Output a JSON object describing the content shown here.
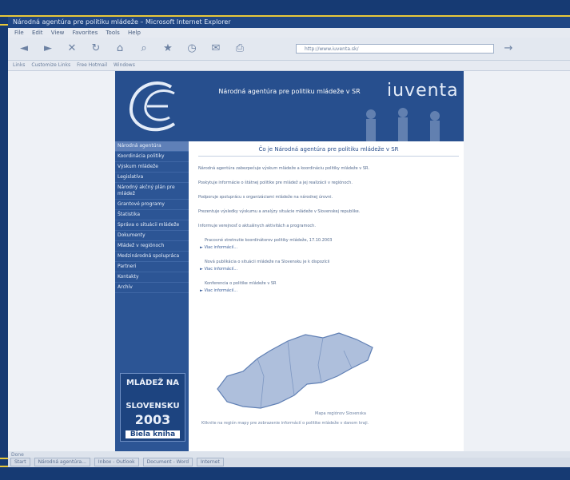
{
  "window": {
    "title": "Národná agentúra pre politiku mládeže – Microsoft Internet Explorer"
  },
  "menu": [
    "File",
    "Edit",
    "View",
    "Favorites",
    "Tools",
    "Help"
  ],
  "address": {
    "url": "http://www.iuventa.sk/"
  },
  "links_bar": [
    "Links",
    "Customize Links",
    "Free Hotmail",
    "Windows"
  ],
  "banner": {
    "title": "Národná agentúra pre politiku mládeže v SR",
    "brand": "iuventa"
  },
  "sidebar": {
    "items": [
      "Národná agentúra",
      "Koordinácia politiky",
      "Výskum mládeže",
      "Legislatíva",
      "Národný akčný plán pre mládež",
      "Grantové programy",
      "Štatistika",
      "Správa o situácii mládeže",
      "Dokumenty",
      "Mládež v regiónoch",
      "Medzinárodná spolupráca",
      "Partneri",
      "Kontakty",
      "Archív"
    ],
    "promo": {
      "line1": "MLÁDEŽ NA",
      "line2": "SLOVENSKU",
      "line3": "2003",
      "line4": "Biela kniha"
    }
  },
  "main": {
    "heading": "Čo je Národná agentúra pre politiku mládeže v SR",
    "paragraphs": [
      "Národná agentúra zabezpečuje výskum mládeže a koordináciu politiky mládeže v SR.",
      "Poskytuje informácie o štátnej politike pre mládež a jej realizácii v regiónoch.",
      "Podporuje spoluprácu s organizáciami mládeže na národnej úrovni.",
      "Prezentuje výsledky výskumu a analýzy situácie mládeže v Slovenskej republike.",
      "Informuje verejnosť o aktuálnych aktivitách a programoch."
    ],
    "news": [
      {
        "text": "Pracovné stretnutie koordinátorov politiky mládeže, 17.10.2003",
        "more": "Viac informácií..."
      },
      {
        "text": "Nová publikácia o situácii mládeže na Slovensku je k dispozícii",
        "more": "Viac informácií..."
      },
      {
        "text": "Konferencia o politike mládeže v SR",
        "more": "Viac informácií..."
      }
    ],
    "map_caption": "Mapa regiónov Slovenska",
    "map_footer": "Kliknite na región mapy pre zobrazenie informácií o politike mládeže v danom kraji."
  },
  "statusbar": {
    "text": "Done"
  },
  "taskbar": {
    "items": [
      "Start",
      "Národná agentúra...",
      "Inbox - Outlook",
      "Document - Word",
      "Internet"
    ]
  }
}
